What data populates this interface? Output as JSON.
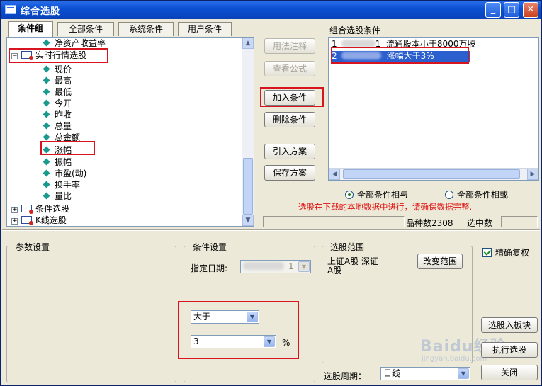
{
  "window": {
    "title": "综合选股"
  },
  "tabs": [
    "条件组",
    "全部条件",
    "系统条件",
    "用户条件"
  ],
  "tree": {
    "top_partial": "净资产收益率",
    "group_realtime": "实时行情选股",
    "items": [
      "现价",
      "最高",
      "最低",
      "今开",
      "昨收",
      "总量",
      "总金额",
      "涨幅",
      "振幅",
      "市盈(动)",
      "换手率",
      "量比"
    ],
    "group_condition": "条件选股",
    "group_k": "K线选股"
  },
  "middle_buttons": {
    "usage": "用法注释",
    "formula": "查看公式",
    "add": "加入条件",
    "delete": "删除条件",
    "import": "引入方案",
    "save": "保存方案"
  },
  "combo": {
    "title": "组合选股条件",
    "row1_prefix": "1",
    "row1_num": "1",
    "row1_text": "流通股本小于8000万股",
    "row2_prefix": "2",
    "row2_text": "涨幅大于3%"
  },
  "logic": {
    "and": "全部条件相与",
    "or": "全部条件相或"
  },
  "notice": "选股在下载的本地数据中进行，请确保数据完整.",
  "stats": {
    "count_label": "品种数",
    "count_value": "2308",
    "selected_label": "选中数"
  },
  "params": {
    "title": "参数设置"
  },
  "cond": {
    "title": "条件设置",
    "date_label": "指定日期:",
    "date_value": "1",
    "operator": "大于",
    "value": "3",
    "unit": "%"
  },
  "range": {
    "title": "选股范围",
    "text_line1": "上证A股 深证",
    "text_line2": "A股",
    "change_button": "改变范围"
  },
  "precise": {
    "label": "精确复权"
  },
  "bottom_buttons": {
    "to_block": "选股入板块",
    "run": "执行选股",
    "close": "关闭"
  },
  "period": {
    "label": "选股周期：",
    "value": "日线"
  },
  "watermark": {
    "brand": "Baidu经验",
    "url": "jingyan.baidu.com"
  }
}
